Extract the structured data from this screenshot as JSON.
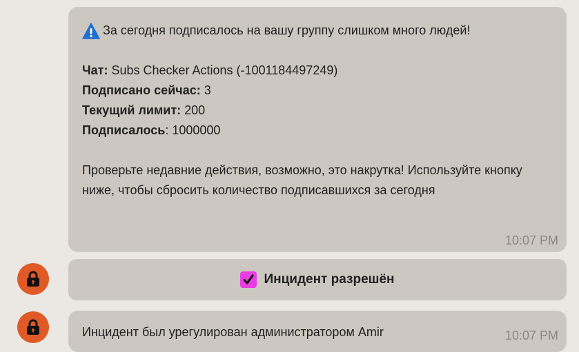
{
  "message1": {
    "warning_text": "За сегодня подписалось на вашу группу слишком много людей!",
    "chat_label": "Чат:",
    "chat_value": " Subs Checker Actions (-1001184497249)",
    "subscribed_now_label": "Подписано сейчас:",
    "subscribed_now_value": " 3",
    "current_limit_label": "Текущий лимит:",
    "current_limit_value": " 200",
    "subscribed_label": "Подписалось",
    "subscribed_value": ": 1000000",
    "advice_text": "Проверьте недавние действия, возможно, это накрутка! Используйте кнопку ниже, чтобы сбросить количество подписавшихся за сегодня",
    "time": "10:07 PM"
  },
  "inline_button": {
    "label": "Инцидент разрешён"
  },
  "message2": {
    "text": "Инцидент был урегулирован администратором Amir",
    "time": "10:07 PM"
  },
  "colors": {
    "avatar": "#e05a27",
    "bubble": "#cdc7c1",
    "background": "#ebe8e3",
    "checkbox": "#e83de0",
    "warning_icon": "#1f6fd1"
  },
  "icons": {
    "warning": "warning-icon",
    "avatar": "lock-icon",
    "check": "checkmark-icon"
  }
}
